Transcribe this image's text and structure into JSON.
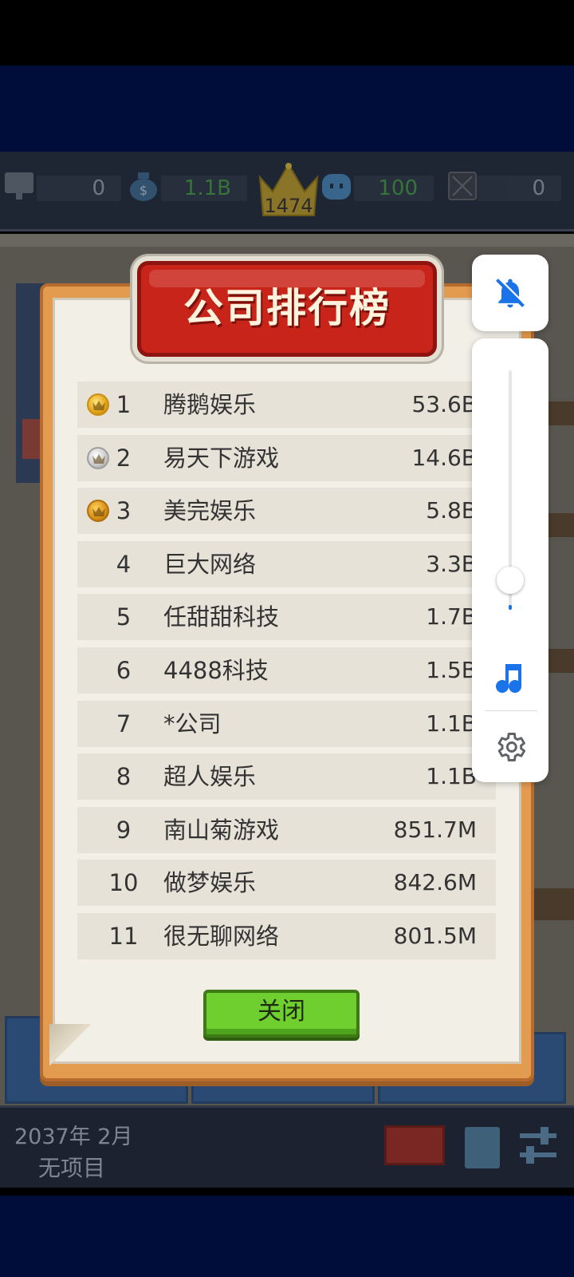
{
  "topbar": {
    "resources": [
      {
        "icon": "monitor-icon",
        "value": "0"
      },
      {
        "icon": "money-bag-icon",
        "value": "1.1B"
      },
      {
        "icon": "fan-face-icon",
        "value": "100"
      },
      {
        "icon": "locked-box-icon",
        "value": "0"
      }
    ],
    "crown_value": "1474"
  },
  "leaderboard": {
    "title": "公司排行榜",
    "rows": [
      {
        "rank": "1",
        "name": "腾鹅娱乐",
        "value": "53.6B",
        "medal": "gold"
      },
      {
        "rank": "2",
        "name": "易天下游戏",
        "value": "14.6B",
        "medal": "silver"
      },
      {
        "rank": "3",
        "name": "美完娱乐",
        "value": "5.8B",
        "medal": "bronze"
      },
      {
        "rank": "4",
        "name": "巨大网络",
        "value": "3.3B",
        "medal": ""
      },
      {
        "rank": "5",
        "name": "任甜甜科技",
        "value": "1.7B",
        "medal": ""
      },
      {
        "rank": "6",
        "name": "4488科技",
        "value": "1.5B",
        "medal": ""
      },
      {
        "rank": "7",
        "name": "*公司",
        "value": "1.1B",
        "medal": ""
      },
      {
        "rank": "8",
        "name": "超人娱乐",
        "value": "1.1B",
        "medal": ""
      },
      {
        "rank": "9",
        "name": "南山菊游戏",
        "value": "851.7M",
        "medal": ""
      },
      {
        "rank": "10",
        "name": "做梦娱乐",
        "value": "842.6M",
        "medal": ""
      },
      {
        "rank": "11",
        "name": "很无聊网络",
        "value": "801.5M",
        "medal": ""
      }
    ],
    "close_label": "关闭"
  },
  "bottombar": {
    "date": "2037年 2月",
    "project": "无项目"
  },
  "volume_panel": {
    "mute_icon": "bell-off-icon",
    "level": 0.02,
    "music_icon": "music-note-icon",
    "settings_icon": "gear-icon",
    "accent_color": "#1a73e8"
  }
}
